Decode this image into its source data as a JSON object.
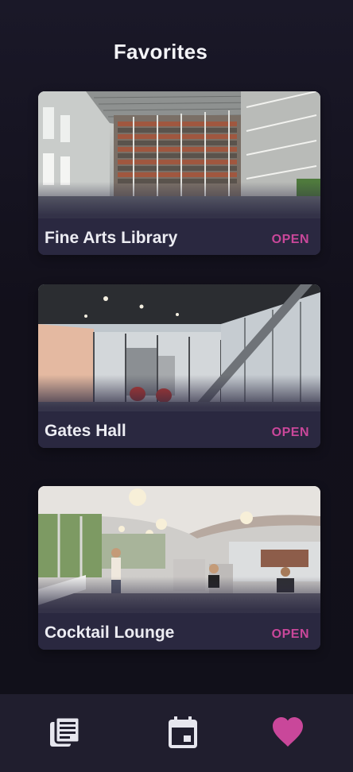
{
  "header": {
    "title": "Favorites"
  },
  "favorites": [
    {
      "name": "Fine Arts Library",
      "status": "OPEN"
    },
    {
      "name": "Gates Hall",
      "status": "OPEN"
    },
    {
      "name": "Cocktail Lounge",
      "status": "OPEN"
    }
  ],
  "bottom_nav": {
    "items": [
      {
        "icon": "news-list-icon",
        "active": false
      },
      {
        "icon": "calendar-icon",
        "active": false
      },
      {
        "icon": "heart-icon",
        "active": true
      }
    ]
  },
  "colors": {
    "background": "#14121e",
    "card": "#2a2840",
    "accent": "#c9479a",
    "nav_bar": "#201e2e",
    "nav_icon": "#e6e6ee"
  }
}
